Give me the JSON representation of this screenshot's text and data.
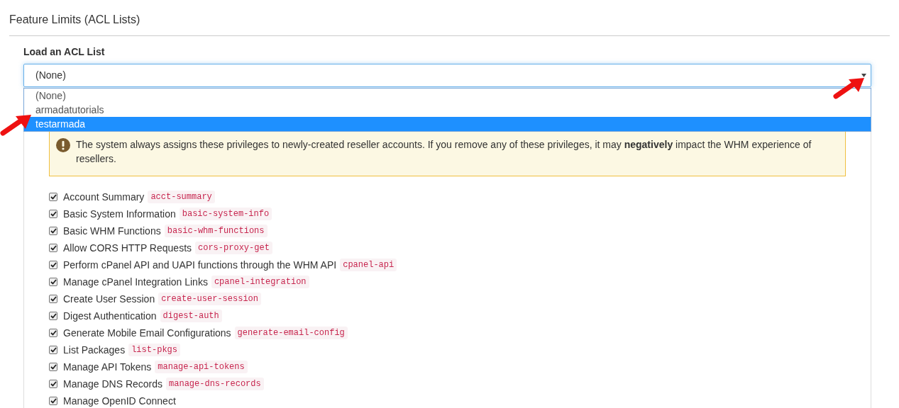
{
  "section_title": "Feature Limits (ACL Lists)",
  "acl_select": {
    "label": "Load an ACL List",
    "value": "(None)",
    "expanded": true,
    "options": [
      {
        "label": "(None)",
        "highlighted": false
      },
      {
        "label": "armadatutorials",
        "highlighted": false
      },
      {
        "label": "testarmada",
        "highlighted": true
      }
    ]
  },
  "alert": {
    "text": "The system always assigns these privileges to newly-created reseller accounts. If you remove any of these privileges, it may **negatively** impact the WHM experience of resellers."
  },
  "privileges": [
    {
      "label": "Account Summary",
      "code": "acct-summary",
      "checked": true
    },
    {
      "label": "Basic System Information",
      "code": "basic-system-info",
      "checked": true
    },
    {
      "label": "Basic WHM Functions",
      "code": "basic-whm-functions",
      "checked": true
    },
    {
      "label": "Allow CORS HTTP Requests",
      "code": "cors-proxy-get",
      "checked": true
    },
    {
      "label": "Perform cPanel API and UAPI functions through the WHM API",
      "code": "cpanel-api",
      "checked": true
    },
    {
      "label": "Manage cPanel Integration Links",
      "code": "cpanel-integration",
      "checked": true
    },
    {
      "label": "Create User Session",
      "code": "create-user-session",
      "checked": true
    },
    {
      "label": "Digest Authentication",
      "code": "digest-auth",
      "checked": true
    },
    {
      "label": "Generate Mobile Email Configurations",
      "code": "generate-email-config",
      "checked": true
    },
    {
      "label": "List Packages",
      "code": "list-pkgs",
      "checked": true
    },
    {
      "label": "Manage API Tokens",
      "code": "manage-api-tokens",
      "checked": true
    },
    {
      "label": "Manage DNS Records",
      "code": "manage-dns-records",
      "checked": true
    },
    {
      "label": "Manage OpenID Connect",
      "checked": true
    }
  ]
}
